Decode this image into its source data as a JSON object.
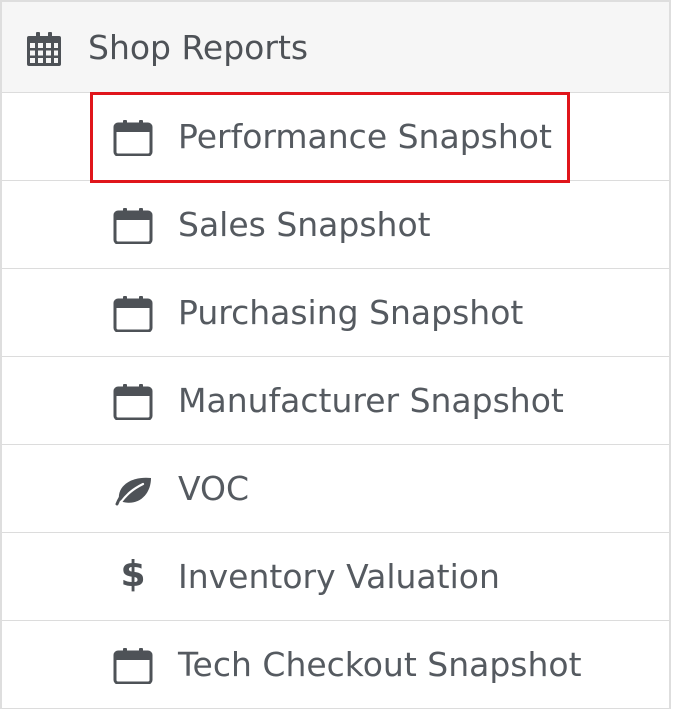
{
  "menu": {
    "header": {
      "label": "Shop Reports",
      "icon": "calendar-grid-icon"
    },
    "items": [
      {
        "label": "Performance Snapshot",
        "icon": "calendar-icon",
        "highlighted": true
      },
      {
        "label": "Sales Snapshot",
        "icon": "calendar-icon",
        "highlighted": false
      },
      {
        "label": "Purchasing Snapshot",
        "icon": "calendar-icon",
        "highlighted": false
      },
      {
        "label": "Manufacturer Snapshot",
        "icon": "calendar-icon",
        "highlighted": false
      },
      {
        "label": "VOC",
        "icon": "leaf-icon",
        "highlighted": false
      },
      {
        "label": "Inventory Valuation",
        "icon": "dollar-icon",
        "highlighted": false
      },
      {
        "label": "Tech Checkout Snapshot",
        "icon": "calendar-icon",
        "highlighted": false
      }
    ]
  },
  "colors": {
    "text": "#555a60",
    "icon": "#4e5257",
    "header_background": "#f6f6f6",
    "divider": "#dcdcdc",
    "highlight_border": "#e0151b"
  }
}
